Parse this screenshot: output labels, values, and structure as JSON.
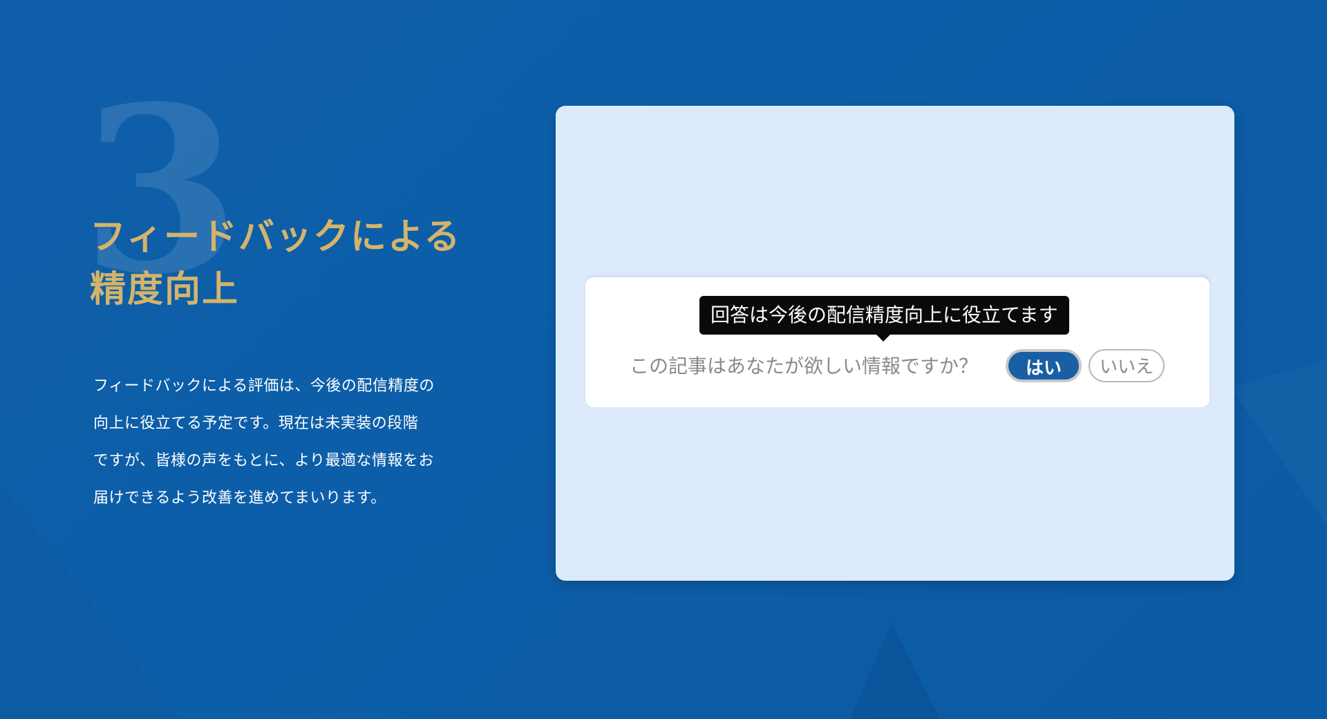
{
  "section": {
    "number": "3",
    "heading_line1": "フィードバックによる",
    "heading_line2": "精度向上",
    "description_lines": [
      "フィードバックによる評価は、今後の配信精度の",
      "向上に役立てる予定です。現在は未実装の段階",
      "ですが、皆様の声をもとに、より最適な情報をお",
      "届けできるよう改善を進めてまいります。"
    ]
  },
  "feedback": {
    "tooltip": "回答は今後の配信精度向上に役立てます",
    "question": "この記事はあなたが欲しい情報ですか？",
    "yes_label": "はい",
    "no_label": "いいえ"
  },
  "colors": {
    "background": "#0e5ea9",
    "heading": "#d4b46a",
    "panel": "#dceafb",
    "yes_button": "#1a5fa5"
  }
}
